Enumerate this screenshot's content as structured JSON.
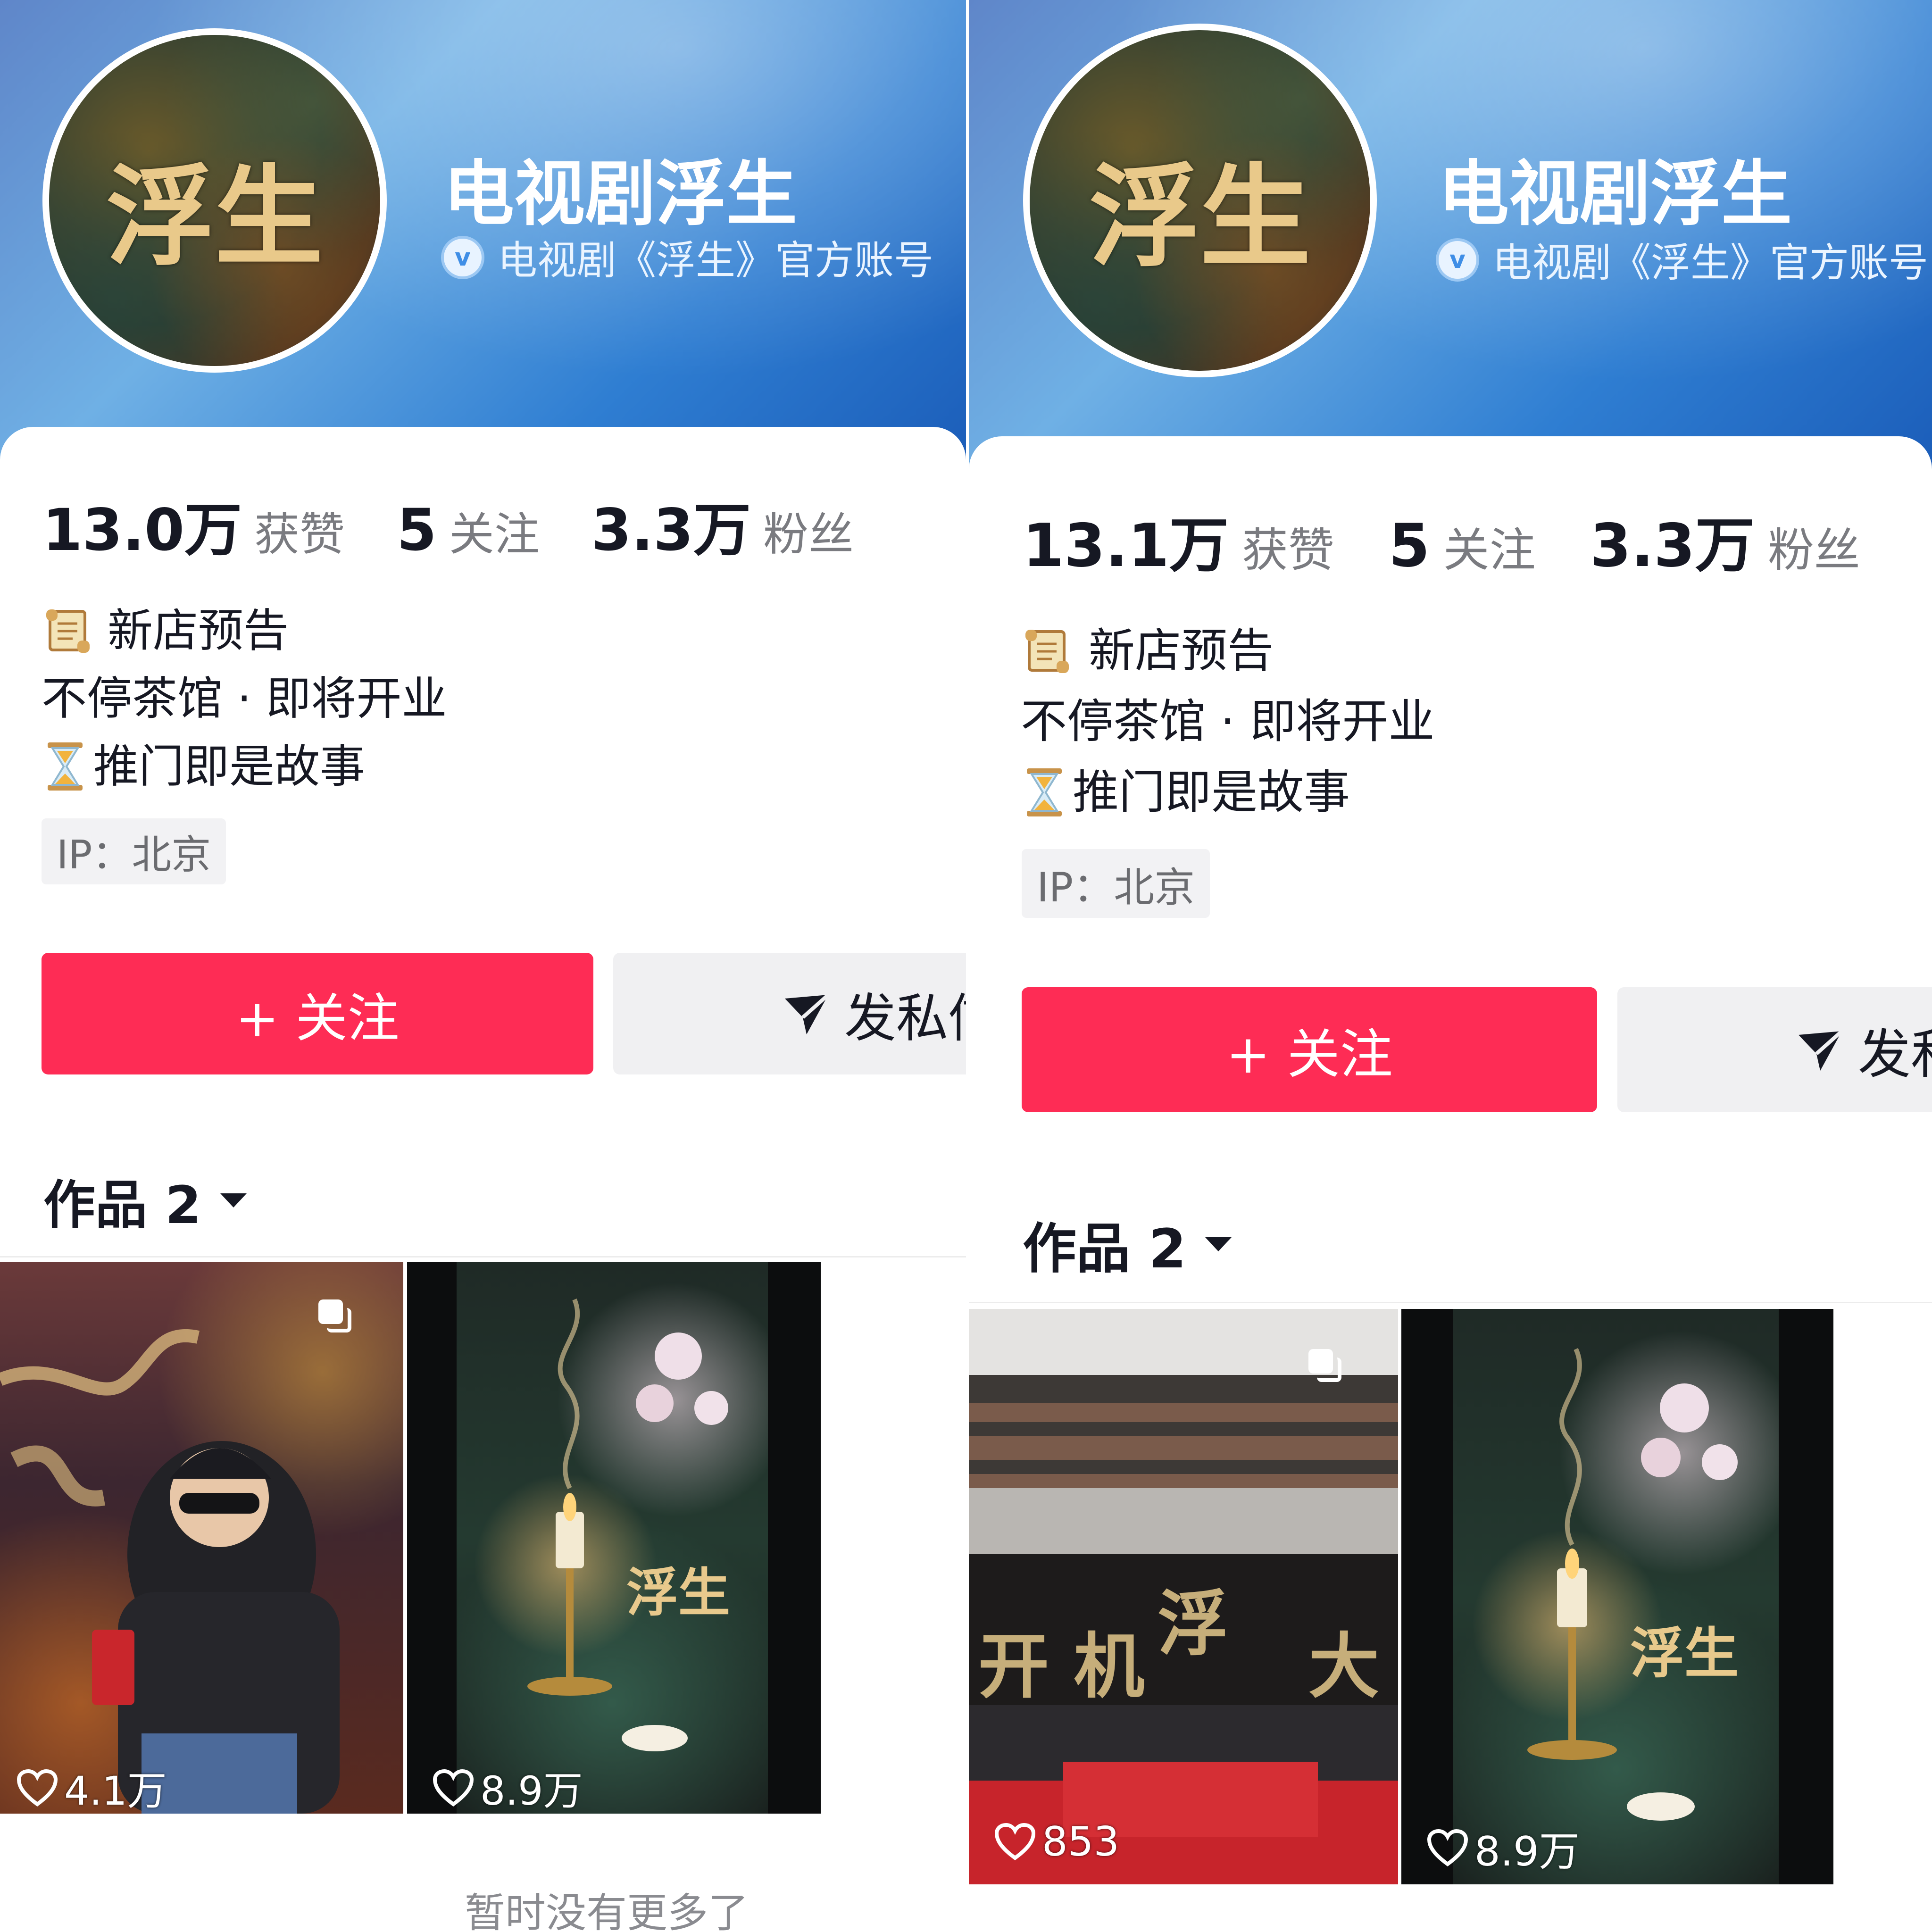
{
  "left": {
    "account_name": "电视剧浮生",
    "verify_text": "电视剧《浮生》官方账号",
    "avatar_logo": "浮生",
    "stats": {
      "likes_num": "13.0万",
      "likes_label": "获赞",
      "following_num": "5",
      "following_label": "关注",
      "followers_num": "3.3万",
      "followers_label": "粉丝"
    },
    "bio": {
      "line1": "新店预告",
      "line2": "不停茶馆 · 即将开业",
      "line3": "推门即是故事"
    },
    "ip": "IP：北京",
    "follow_button": "+ 关注",
    "dm_button": "发私信",
    "works_label": "作品 2",
    "thumbs": [
      {
        "likes": "4.1万"
      },
      {
        "likes": "8.9万"
      }
    ],
    "no_more": "暂时没有更多了"
  },
  "right": {
    "account_name": "电视剧浮生",
    "verify_text": "电视剧《浮生》官方账号",
    "avatar_logo": "浮生",
    "stats": {
      "likes_num": "13.1万",
      "likes_label": "获赞",
      "following_num": "5",
      "following_label": "关注",
      "followers_num": "3.3万",
      "followers_label": "粉丝"
    },
    "bio": {
      "line1": "新店预告",
      "line2": "不停茶馆 · 即将开业",
      "line3": "推门即是故事"
    },
    "ip": "IP：北京",
    "follow_button": "+ 关注",
    "dm_button": "发私信",
    "works_label": "作品 2",
    "thumbs": [
      {
        "likes": "853"
      },
      {
        "likes": "8.9万"
      }
    ]
  },
  "icons": {
    "verify": "verified-badge-icon",
    "scroll": "scroll-emoji-icon",
    "hourglass": "hourglass-emoji-icon",
    "send": "send-icon",
    "heart": "heart-icon",
    "dropdown": "triangle-down-icon",
    "multi": "multi-image-icon"
  },
  "colors": {
    "accent": "#fe2c55",
    "header_blue": "#2f7ed2"
  }
}
